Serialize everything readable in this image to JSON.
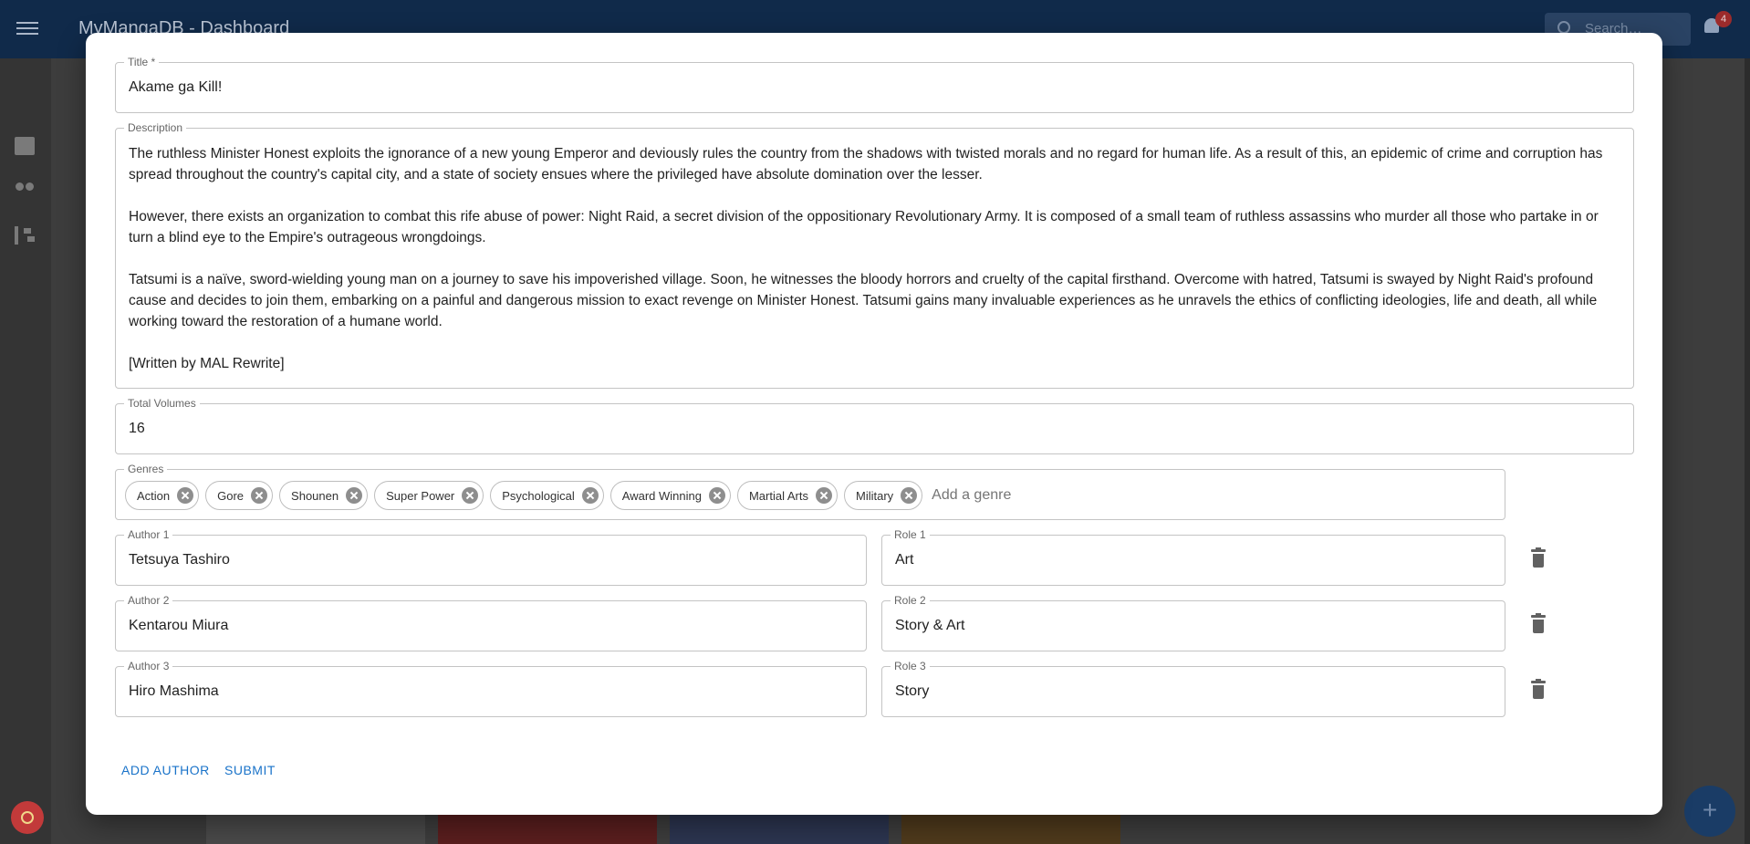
{
  "app": {
    "title": "MyMangaDB - Dashboard",
    "search_placeholder": "Search…",
    "notification_count": "4"
  },
  "dialog": {
    "title_field": {
      "label": "Title *",
      "value": "Akame ga Kill!"
    },
    "description_field": {
      "label": "Description",
      "paragraphs": [
        "The ruthless Minister Honest exploits the ignorance of a new young Emperor and deviously rules the country from the shadows with twisted morals and no regard for human life. As a result of this, an epidemic of crime and corruption has spread throughout the country's capital city, and a state of society ensues where the privileged have absolute domination over the lesser.",
        "However, there exists an organization to combat this rife abuse of power: Night Raid, a secret division of the oppositionary Revolutionary Army. It is composed of a small team of ruthless assassins who murder all those who partake in or turn a blind eye to the Empire's outrageous wrongdoings.",
        "Tatsumi is a naïve, sword-wielding young man on a journey to save his impoverished village. Soon, he witnesses the bloody horrors and cruelty of the capital firsthand. Overcome with hatred, Tatsumi is swayed by Night Raid's profound cause and decides to join them, embarking on a painful and dangerous mission to exact revenge on Minister Honest. Tatsumi gains many invaluable experiences as he unravels the ethics of conflicting ideologies, life and death, all while working toward the restoration of a humane world.",
        "[Written by MAL Rewrite]"
      ]
    },
    "volumes_field": {
      "label": "Total Volumes",
      "value": "16"
    },
    "genres_field": {
      "label": "Genres",
      "chips": [
        "Action",
        "Gore",
        "Shounen",
        "Super Power",
        "Psychological",
        "Award Winning",
        "Martial Arts",
        "Military"
      ],
      "placeholder": "Add a genre"
    },
    "authors": [
      {
        "author_label": "Author 1",
        "author": "Tetsuya Tashiro",
        "role_label": "Role 1",
        "role": "Art"
      },
      {
        "author_label": "Author 2",
        "author": "Kentarou Miura",
        "role_label": "Role 2",
        "role": "Story & Art"
      },
      {
        "author_label": "Author 3",
        "author": "Hiro Mashima",
        "role_label": "Role 3",
        "role": "Story"
      }
    ],
    "actions": {
      "add_author": "ADD AUTHOR",
      "submit": "SUBMIT"
    }
  },
  "colors": {
    "accent": "#1a73c9",
    "appbar": "#102a4a",
    "backdrop": "#3d3d3d"
  }
}
